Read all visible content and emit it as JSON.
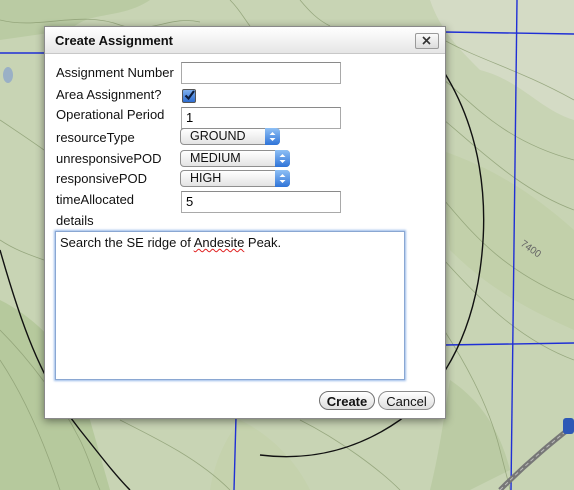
{
  "map": {
    "contour_label": "7400"
  },
  "dialog": {
    "title": "Create Assignment",
    "close_icon": "close-icon"
  },
  "form": {
    "assignment_number": {
      "label": "Assignment Number",
      "value": ""
    },
    "area_assignment": {
      "label": "Area Assignment?",
      "checked": true
    },
    "operational_period": {
      "label": "Operational Period",
      "value": "1"
    },
    "resource_type": {
      "label": "resourceType",
      "value": "GROUND"
    },
    "unresponsive_pod": {
      "label": "unresponsivePOD",
      "value": "MEDIUM"
    },
    "responsive_pod": {
      "label": "responsivePOD",
      "value": "HIGH"
    },
    "time_allocated": {
      "label": "timeAllocated",
      "value": "5"
    },
    "details": {
      "label": "details",
      "text_before": "Search the SE ridge of ",
      "misspelled_word": "Andesite",
      "text_after": " Peak."
    }
  },
  "buttons": {
    "create": "Create",
    "cancel": "Cancel"
  },
  "colors": {
    "map_background": "#c7d3b3",
    "grid_line": "#1f2fd6",
    "accent_blue": "#2f74d8"
  }
}
